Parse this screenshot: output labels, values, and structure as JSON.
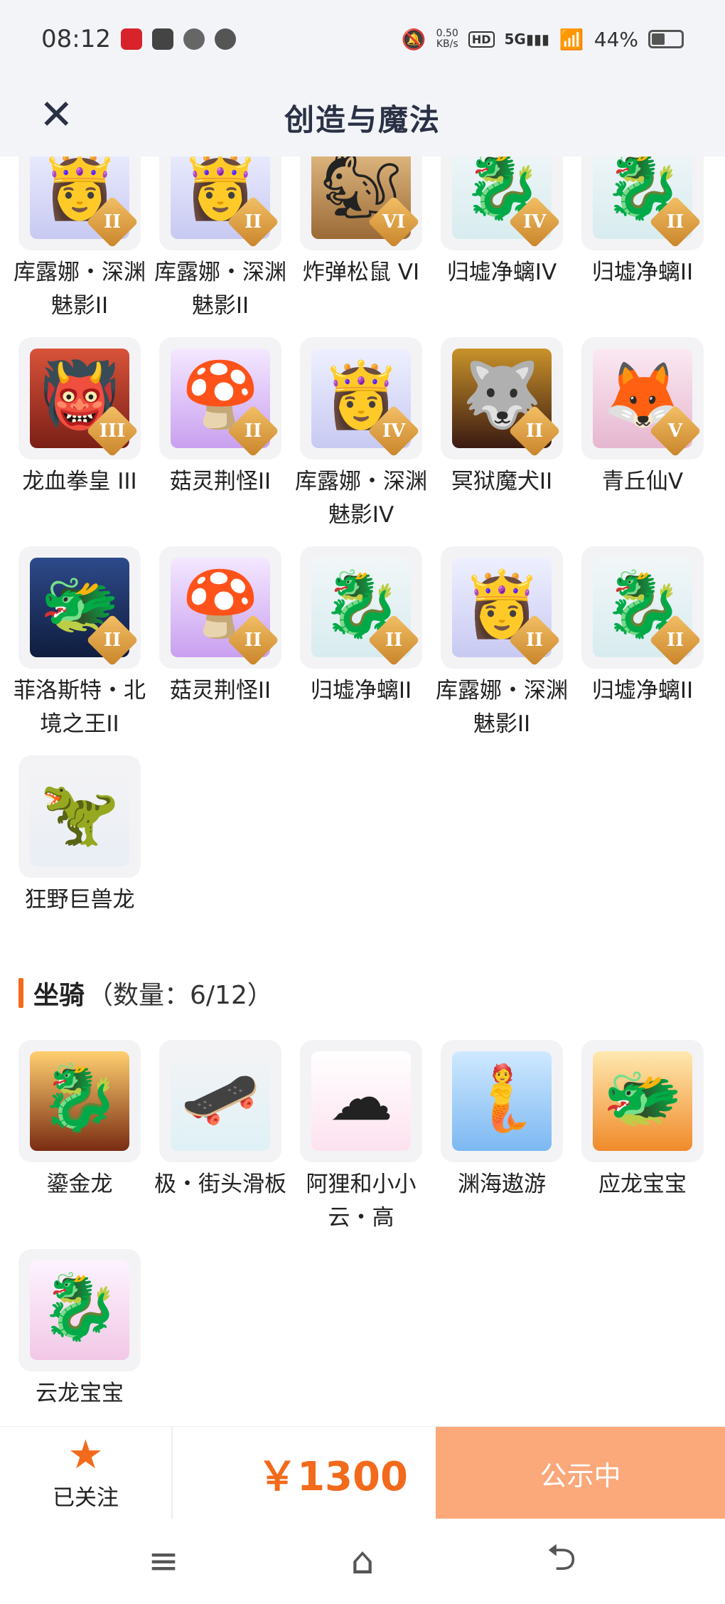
{
  "status_bar": {
    "time": "08:12",
    "netspeed_value": "0.50",
    "netspeed_unit": "KB/s",
    "hd_label": "HD",
    "network": "5G",
    "battery": "44%"
  },
  "header": {
    "title": "创造与魔法"
  },
  "pets": [
    {
      "name": "库露娜・深渊魅影II",
      "tier": "II",
      "icon": "ghost-maiden"
    },
    {
      "name": "库露娜・深渊魅影II",
      "tier": "II",
      "icon": "ghost-maiden"
    },
    {
      "name": "炸弹松鼠 VI",
      "tier": "VI",
      "icon": "squirrel"
    },
    {
      "name": "归墟净螭IV",
      "tier": "IV",
      "icon": "dragon-teal"
    },
    {
      "name": "归墟净螭II",
      "tier": "II",
      "icon": "dragon-teal"
    },
    {
      "name": "龙血拳皇 III",
      "tier": "III",
      "icon": "red-beast"
    },
    {
      "name": "菇灵荆怪II",
      "tier": "II",
      "icon": "mushroom-sprite"
    },
    {
      "name": "库露娜・深渊魅影IV",
      "tier": "IV",
      "icon": "ghost-maiden"
    },
    {
      "name": "冥狱魔犬II",
      "tier": "II",
      "icon": "hellhound"
    },
    {
      "name": "青丘仙V",
      "tier": "V",
      "icon": "fox-fairy"
    },
    {
      "name": "菲洛斯特・北境之王II",
      "tier": "II",
      "icon": "ice-dragon"
    },
    {
      "name": "菇灵荆怪II",
      "tier": "II",
      "icon": "mushroom-sprite"
    },
    {
      "name": "归墟净螭II",
      "tier": "II",
      "icon": "dragon-teal"
    },
    {
      "name": "库露娜・深渊魅影II",
      "tier": "II",
      "icon": "ghost-maiden"
    },
    {
      "name": "归墟净螭II",
      "tier": "II",
      "icon": "dragon-teal"
    },
    {
      "name": "狂野巨兽龙",
      "tier": "",
      "icon": "wild-dinosaur"
    }
  ],
  "mounts_section": {
    "title": "坐骑",
    "count": "（数量：6/12）"
  },
  "mounts": [
    {
      "name": "鎏金龙",
      "icon": "gold-dragon"
    },
    {
      "name": "极・街头滑板",
      "icon": "skateboard"
    },
    {
      "name": "阿狸和小小云・高",
      "icon": "fox-cloud"
    },
    {
      "name": "渊海遨游",
      "icon": "sea-girl"
    },
    {
      "name": "应龙宝宝",
      "icon": "baby-dragon"
    },
    {
      "name": "云龙宝宝",
      "icon": "cloud-dragon"
    }
  ],
  "footer": {
    "follow_label": "已关注",
    "price": "￥1300",
    "public_label": "公示中"
  }
}
